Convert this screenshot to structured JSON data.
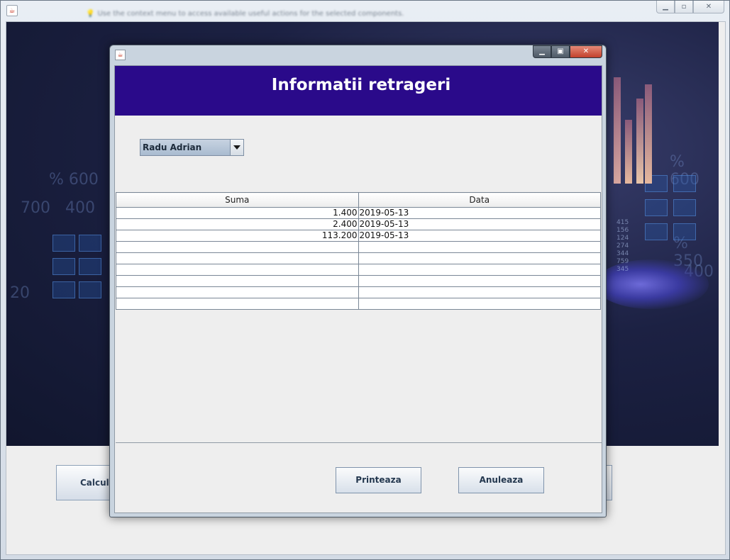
{
  "main_window": {
    "hint": "Use the context menu to access available useful actions for the selected components.",
    "calcula_label": "Calcula"
  },
  "dialog": {
    "title": "Informatii retrageri",
    "client_select": {
      "selected": "Radu Adrian"
    },
    "table": {
      "columns": [
        "Suma",
        "Data"
      ],
      "rows": [
        {
          "suma": "1.400",
          "data": "2019-05-13"
        },
        {
          "suma": "2.400",
          "data": "2019-05-13"
        },
        {
          "suma": "113.200",
          "data": "2019-05-13"
        },
        {
          "suma": "",
          "data": ""
        },
        {
          "suma": "",
          "data": ""
        },
        {
          "suma": "",
          "data": ""
        },
        {
          "suma": "",
          "data": ""
        },
        {
          "suma": "",
          "data": ""
        },
        {
          "suma": "",
          "data": ""
        }
      ]
    },
    "buttons": {
      "print": "Printeaza",
      "cancel": "Anuleaza"
    }
  },
  "icons": {
    "java": "java-icon",
    "window_controls": [
      "minimize-icon",
      "maximize-icon",
      "close-icon"
    ]
  }
}
